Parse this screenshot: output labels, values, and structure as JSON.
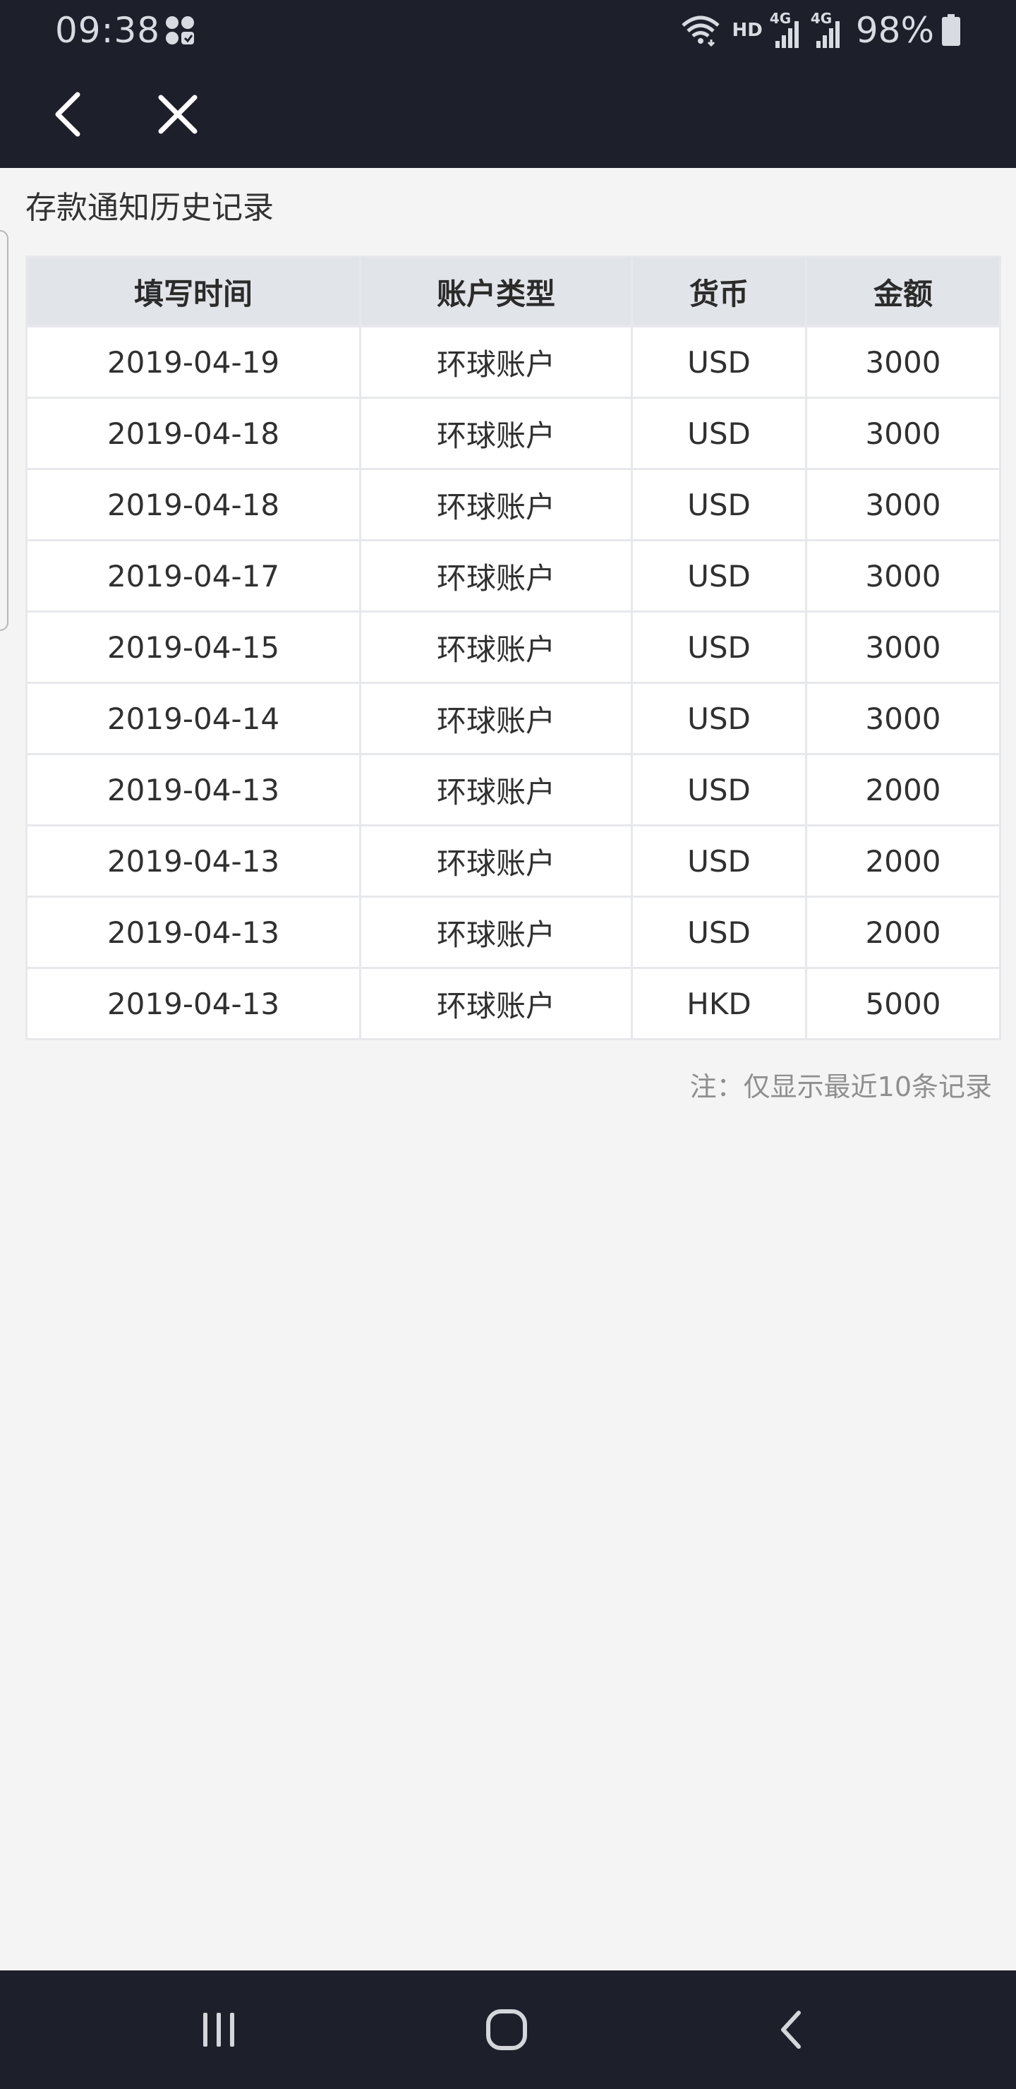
{
  "status_bar": {
    "time": "09:38",
    "hd_label": "HD",
    "network_1": "4G",
    "network_2": "4G",
    "battery": "98%",
    "icons": [
      "app-notification-icon",
      "wifi-icon",
      "signal-icon",
      "signal-icon",
      "battery-icon"
    ]
  },
  "app_bar": {
    "back_icon": "chevron-left-icon",
    "close_icon": "close-icon"
  },
  "page": {
    "title": "存款通知历史记录",
    "note": "注：仅显示最近10条记录"
  },
  "table": {
    "headers": [
      "填写时间",
      "账户类型",
      "货币",
      "金额"
    ],
    "rows": [
      [
        "2019-04-19",
        "环球账户",
        "USD",
        "3000"
      ],
      [
        "2019-04-18",
        "环球账户",
        "USD",
        "3000"
      ],
      [
        "2019-04-18",
        "环球账户",
        "USD",
        "3000"
      ],
      [
        "2019-04-17",
        "环球账户",
        "USD",
        "3000"
      ],
      [
        "2019-04-15",
        "环球账户",
        "USD",
        "3000"
      ],
      [
        "2019-04-14",
        "环球账户",
        "USD",
        "3000"
      ],
      [
        "2019-04-13",
        "环球账户",
        "USD",
        "2000"
      ],
      [
        "2019-04-13",
        "环球账户",
        "USD",
        "2000"
      ],
      [
        "2019-04-13",
        "环球账户",
        "USD",
        "2000"
      ],
      [
        "2019-04-13",
        "环球账户",
        "HKD",
        "5000"
      ]
    ]
  },
  "nav_bar": {
    "icons": [
      "recent-apps-icon",
      "home-icon",
      "back-icon"
    ]
  },
  "colors": {
    "dark_bar": "#1d1f2a",
    "page_background": "#f4f4f4",
    "table_header": "#e1e4e8",
    "table_border": "#e7e8eb",
    "note_text": "#8f8f8f"
  }
}
